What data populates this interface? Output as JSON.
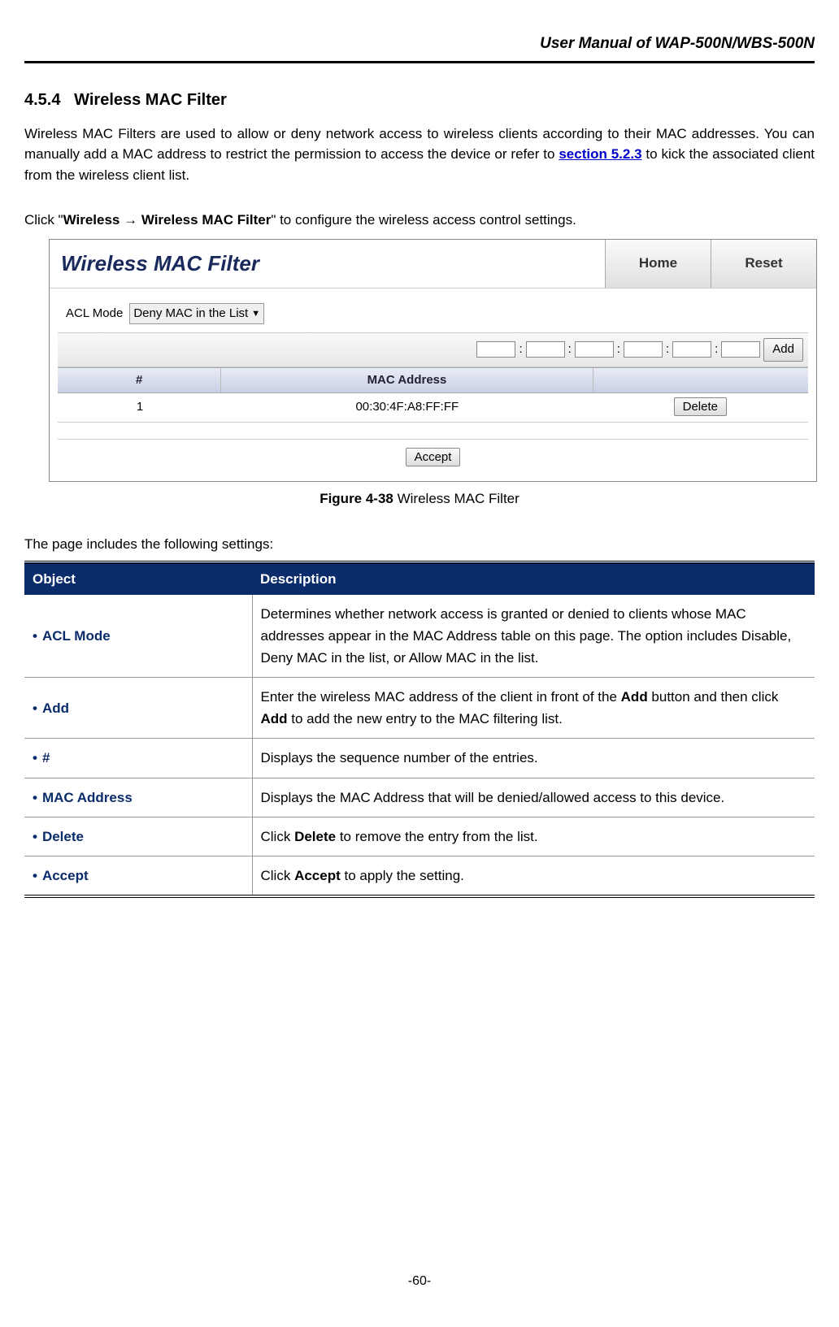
{
  "header_title": "User Manual of WAP-500N/WBS-500N",
  "section_number": "4.5.4",
  "section_title": "Wireless MAC Filter",
  "intro_part1": "Wireless MAC Filters are used to allow or deny network access to wireless clients according to their MAC addresses. You can manually add a MAC address to restrict the permission to access the device or refer to ",
  "intro_link": "section 5.2.3",
  "intro_part2": " to kick the associated client from the wireless client list.",
  "click_part1": "Click \"",
  "click_bold": "Wireless → Wireless MAC Filter",
  "click_part2": "\" to configure the wireless access control settings.",
  "ui": {
    "title": "Wireless MAC Filter",
    "home_tab": "Home",
    "reset_tab": "Reset",
    "acl_label": "ACL Mode",
    "acl_value": "Deny MAC in the List",
    "colon": ":",
    "add_btn": "Add",
    "th1": "#",
    "th2": "MAC Address",
    "row1_num": "1",
    "row1_mac": "00:30:4F:A8:FF:FF",
    "delete_btn": "Delete",
    "accept_btn": "Accept"
  },
  "figure_label": "Figure 4-38",
  "figure_caption": " Wireless MAC Filter",
  "settings_intro": "The page includes the following settings:",
  "table": {
    "h1": "Object",
    "h2": "Description",
    "rows": [
      {
        "obj": "ACL Mode",
        "desc_parts": [
          "Determines whether network access is granted or denied to clients whose MAC addresses appear in the MAC Address table on this page. The option includes Disable, Deny MAC in the list, or Allow MAC in the list."
        ]
      },
      {
        "obj": "Add",
        "desc_parts": [
          "Enter the wireless MAC address of the client in front of the ",
          "Add",
          " button and then click ",
          "Add",
          " to add the new entry to the MAC filtering list."
        ]
      },
      {
        "obj": "#",
        "desc_parts": [
          "Displays the sequence number of the entries."
        ]
      },
      {
        "obj": "MAC Address",
        "desc_parts": [
          "Displays the MAC Address that will be denied/allowed access to this device."
        ]
      },
      {
        "obj": "Delete",
        "desc_parts": [
          "Click ",
          "Delete",
          " to remove the entry from the list."
        ]
      },
      {
        "obj": "Accept",
        "desc_parts": [
          "Click ",
          "Accept",
          " to apply the setting."
        ]
      }
    ]
  },
  "page_number": "-60-"
}
